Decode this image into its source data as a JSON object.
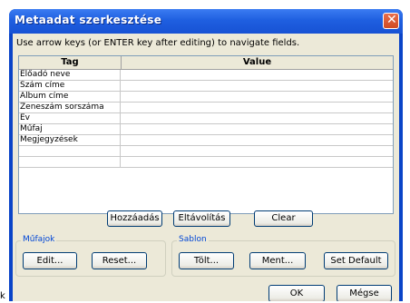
{
  "window": {
    "title": "Metaadat szerkesztése",
    "close_glyph": "✕"
  },
  "instruction": "Use arrow keys (or ENTER key after editing) to navigate fields.",
  "table": {
    "columns": [
      "Tag",
      "Value"
    ],
    "rows": [
      {
        "tag": "Előadó neve",
        "value": ""
      },
      {
        "tag": "Szám címe",
        "value": ""
      },
      {
        "tag": "Album címe",
        "value": ""
      },
      {
        "tag": "Zeneszám sorszáma",
        "value": ""
      },
      {
        "tag": "Év",
        "value": ""
      },
      {
        "tag": "Műfaj",
        "value": ""
      },
      {
        "tag": "Megjegyzések",
        "value": ""
      },
      {
        "tag": "",
        "value": ""
      },
      {
        "tag": "",
        "value": ""
      }
    ]
  },
  "buttons": {
    "add": "Hozzáadás",
    "remove": "Eltávolítás",
    "clear": "Clear"
  },
  "mufajok": {
    "label": "Műfajok",
    "edit": "Edit...",
    "reset": "Reset..."
  },
  "sablon": {
    "label": "Sablon",
    "load": "Tölt...",
    "save": "Ment...",
    "set_default": "Set Default"
  },
  "dialog": {
    "ok": "OK",
    "cancel": "Mégse"
  },
  "background_text": "k",
  "colors": {
    "title_bar": "#1f5fe0",
    "client": "#ece9d8",
    "group_label": "#0046d5",
    "button_border": "#003c74",
    "close_button": "#d04a22"
  }
}
